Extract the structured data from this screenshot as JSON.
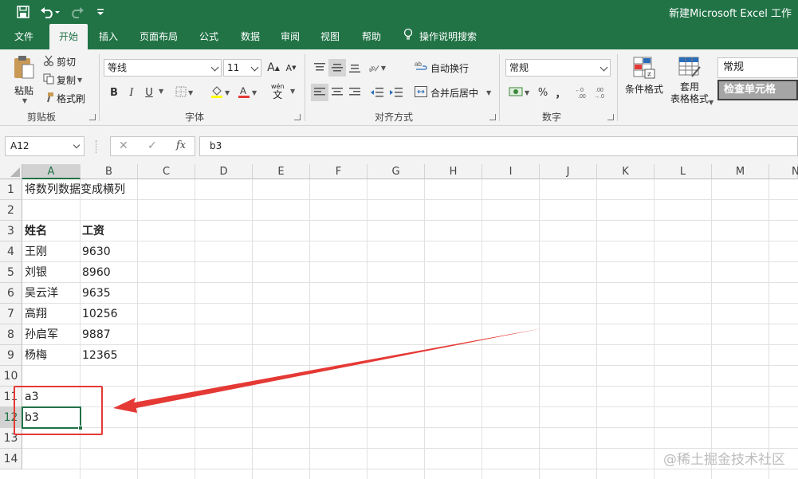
{
  "titlebar": {
    "title": "新建Microsoft Excel 工作",
    "save_icon": "save-icon",
    "undo_icon": "undo-icon",
    "redo_icon": "redo-icon",
    "customize_icon": "customize-qat-icon"
  },
  "tabs": {
    "file": "文件",
    "home": "开始",
    "insert": "插入",
    "page_layout": "页面布局",
    "formulas": "公式",
    "data": "数据",
    "review": "审阅",
    "view": "视图",
    "help": "帮助",
    "tell_me": "操作说明搜索"
  },
  "ribbon": {
    "clipboard": {
      "paste": "粘贴",
      "cut": "剪切",
      "copy": "复制",
      "format_painter": "格式刷",
      "label": "剪贴板"
    },
    "font": {
      "name": "等线",
      "size": "11",
      "grow": "A",
      "shrink": "A",
      "bold": "B",
      "italic": "I",
      "underline": "U",
      "label": "字体",
      "wen": "wén",
      "wen2": "文"
    },
    "alignment": {
      "wrap": "自动换行",
      "merge": "合并后居中",
      "label": "对齐方式"
    },
    "number": {
      "format": "常规",
      "percent": "%",
      "comma": "，",
      "label": "数字"
    },
    "styles": {
      "cond_format": "条件格式",
      "table_format1": "套用",
      "table_format2": "表格格式",
      "normal": "常规",
      "check_cell": "检查单元格"
    }
  },
  "formula_bar": {
    "name_box": "A12",
    "cancel": "✕",
    "enter": "✓",
    "fx": "fx",
    "content": "b3"
  },
  "sheet": {
    "columns": [
      "A",
      "B",
      "C",
      "D",
      "E",
      "F",
      "G",
      "H",
      "I",
      "J",
      "K",
      "L",
      "M",
      "N"
    ],
    "rows": [
      "1",
      "2",
      "3",
      "4",
      "5",
      "6",
      "7",
      "8",
      "9",
      "10",
      "11",
      "12",
      "13",
      "14"
    ],
    "cells": {
      "a1": "将数列数据变成横列",
      "a3": "姓名",
      "b3": "工资",
      "a4": "王刚",
      "b4": "9630",
      "a5": "刘银",
      "b5": "8960",
      "a6": "吴云洋",
      "b6": "9635",
      "a7": "高翔",
      "b7": "10256",
      "a8": "孙启军",
      "b8": "9887",
      "a9": "杨梅",
      "b9": "12365",
      "a11": "a3",
      "a12": "b3"
    }
  },
  "watermark": "@稀土掘金技术社区",
  "colors": {
    "excel_green": "#217346",
    "annotation_red": "#e53935"
  }
}
